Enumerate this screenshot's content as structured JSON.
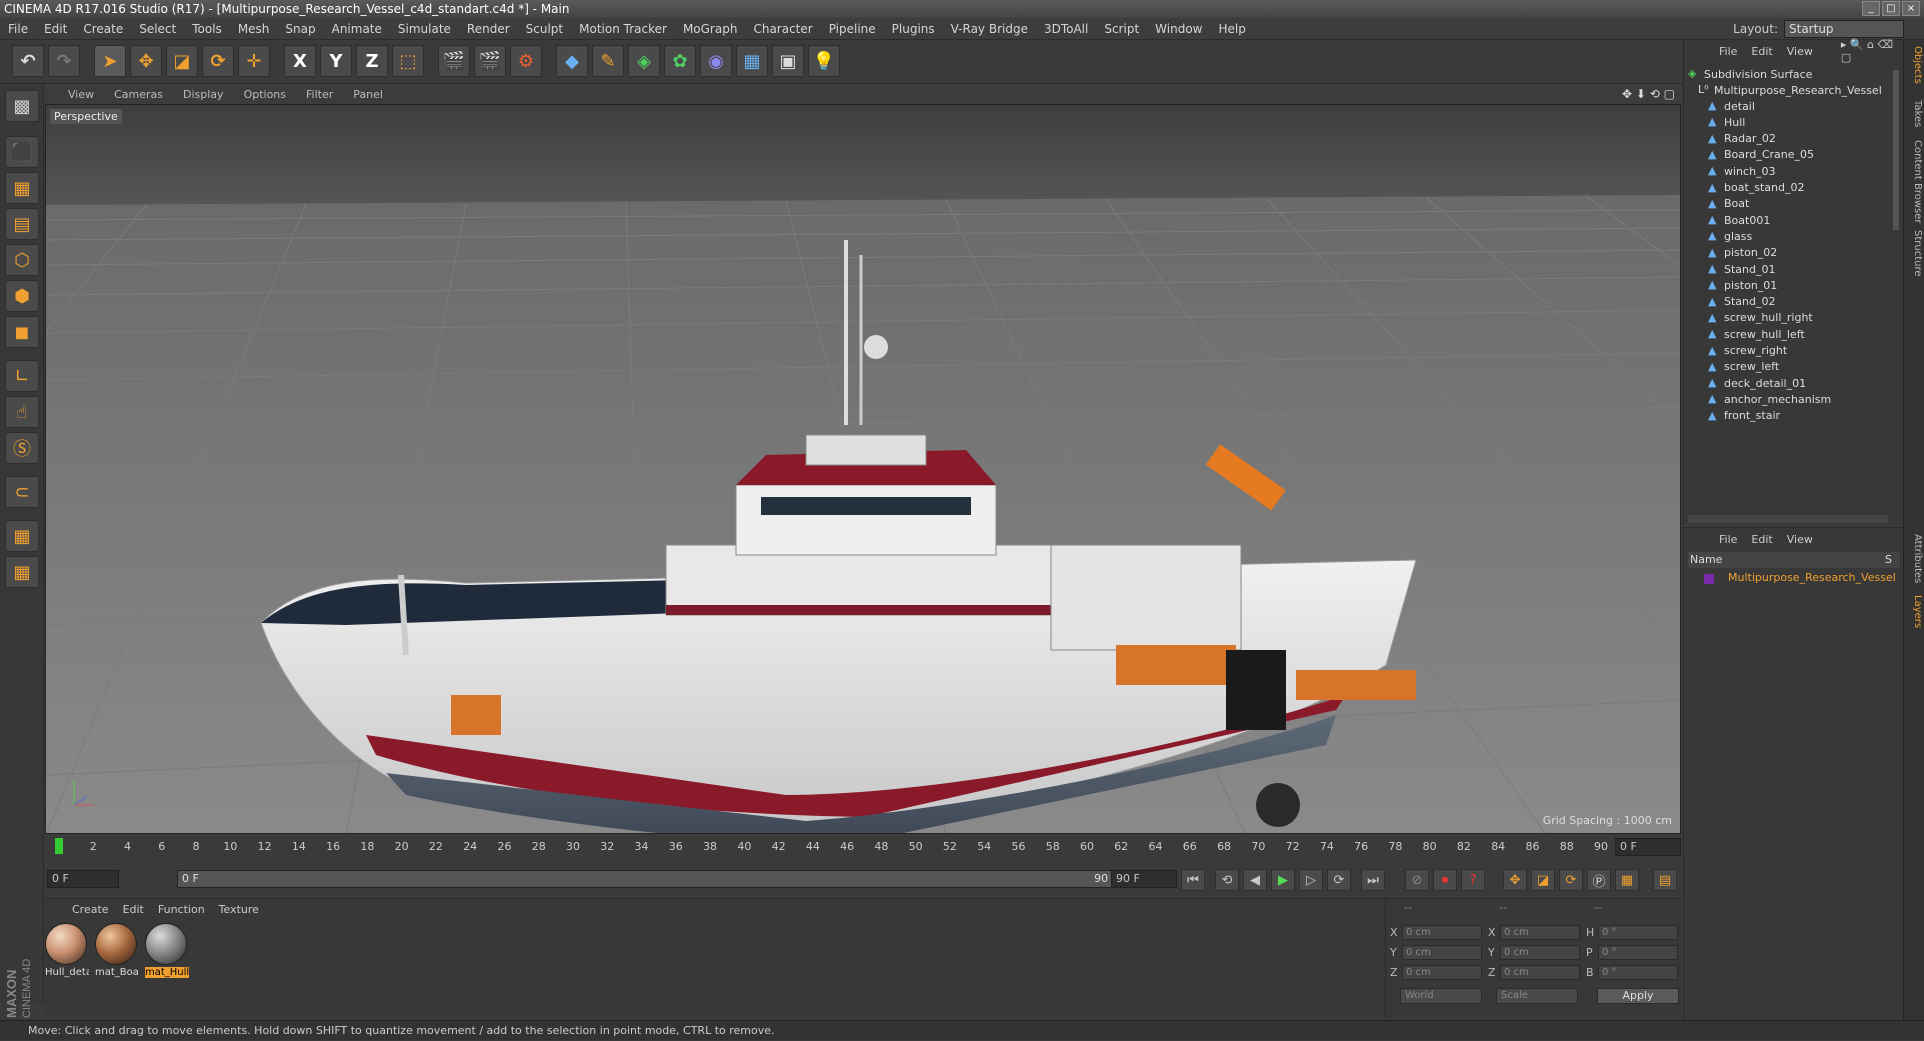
{
  "window": {
    "title": "CINEMA 4D R17.016 Studio (R17) - [Multipurpose_Research_Vessel_c4d_standart.c4d *] - Main",
    "controls": [
      "_",
      "□",
      "×"
    ]
  },
  "menu": [
    "File",
    "Edit",
    "Create",
    "Select",
    "Tools",
    "Mesh",
    "Snap",
    "Animate",
    "Simulate",
    "Render",
    "Sculpt",
    "Motion Tracker",
    "MoGraph",
    "Character",
    "Pipeline",
    "Plugins",
    "V-Ray Bridge",
    "3DToAll",
    "Script",
    "Window",
    "Help"
  ],
  "layout": {
    "label": "Layout:",
    "value": "Startup"
  },
  "toolbar": {
    "axis_x": "X",
    "axis_y": "Y",
    "axis_z": "Z"
  },
  "viewport": {
    "menu": [
      "View",
      "Cameras",
      "Display",
      "Options",
      "Filter",
      "Panel"
    ],
    "label": "Perspective",
    "grid_spacing": "Grid Spacing : 1000 cm"
  },
  "timeline": {
    "ticks": [
      "0",
      "2",
      "4",
      "6",
      "8",
      "10",
      "12",
      "14",
      "16",
      "18",
      "20",
      "22",
      "24",
      "26",
      "28",
      "30",
      "32",
      "34",
      "36",
      "38",
      "40",
      "42",
      "44",
      "46",
      "48",
      "50",
      "52",
      "54",
      "56",
      "58",
      "60",
      "62",
      "64",
      "66",
      "68",
      "70",
      "72",
      "74",
      "76",
      "78",
      "80",
      "82",
      "84",
      "86",
      "88",
      "90"
    ],
    "current_frame": "0 F"
  },
  "playback": {
    "start_field": "0 F",
    "slider_start": "0 F",
    "slider_end": "90 F",
    "end_field": "90 F"
  },
  "materials": {
    "menu": [
      "Create",
      "Edit",
      "Function",
      "Texture"
    ],
    "items": [
      {
        "label": "Hull_deta",
        "color": "#c89070"
      },
      {
        "label": "mat_Boa",
        "color": "#a86a40"
      },
      {
        "label": "mat_Hull",
        "color": "#8a8a8a"
      }
    ]
  },
  "coords": {
    "header": [
      "--",
      "--",
      "--"
    ],
    "rows": [
      {
        "a1": "X",
        "v1": "0 cm",
        "a2": "X",
        "v2": "0 cm",
        "a3": "H",
        "v3": "0 °"
      },
      {
        "a1": "Y",
        "v1": "0 cm",
        "a2": "Y",
        "v2": "0 cm",
        "a3": "P",
        "v3": "0 °"
      },
      {
        "a1": "Z",
        "v1": "0 cm",
        "a2": "Z",
        "v2": "0 cm",
        "a3": "B",
        "v3": "0 °"
      }
    ],
    "world": "World",
    "scale": "Scale",
    "apply": "Apply"
  },
  "objects": {
    "menu": [
      "File",
      "Edit",
      "View"
    ],
    "root": "Subdivision Surface",
    "group": "Multipurpose_Research_Vessel",
    "children": [
      "detail",
      "Hull",
      "Radar_02",
      "Board_Crane_05",
      "winch_03",
      "boat_stand_02",
      "Boat",
      "Boat001",
      "glass",
      "piston_02",
      "Stand_01",
      "piston_01",
      "Stand_02",
      "screw_hull_right",
      "screw_hull_left",
      "screw_right",
      "screw_left",
      "deck_detail_01",
      "anchor_mechanism",
      "front_stair"
    ]
  },
  "layers": {
    "menu": [
      "File",
      "Edit",
      "View"
    ],
    "col_name": "Name",
    "col_s": "S",
    "row": "Multipurpose_Research_Vessel"
  },
  "side_tabs": [
    "Objects",
    "Takes",
    "Content Browser",
    "Structure",
    "Attributes",
    "Layers"
  ],
  "status": "Move: Click and drag to move elements. Hold down SHIFT to quantize movement / add to the selection in point mode, CTRL to remove.",
  "brand": {
    "line1": "MAXON",
    "line2": "CINEMA 4D"
  }
}
